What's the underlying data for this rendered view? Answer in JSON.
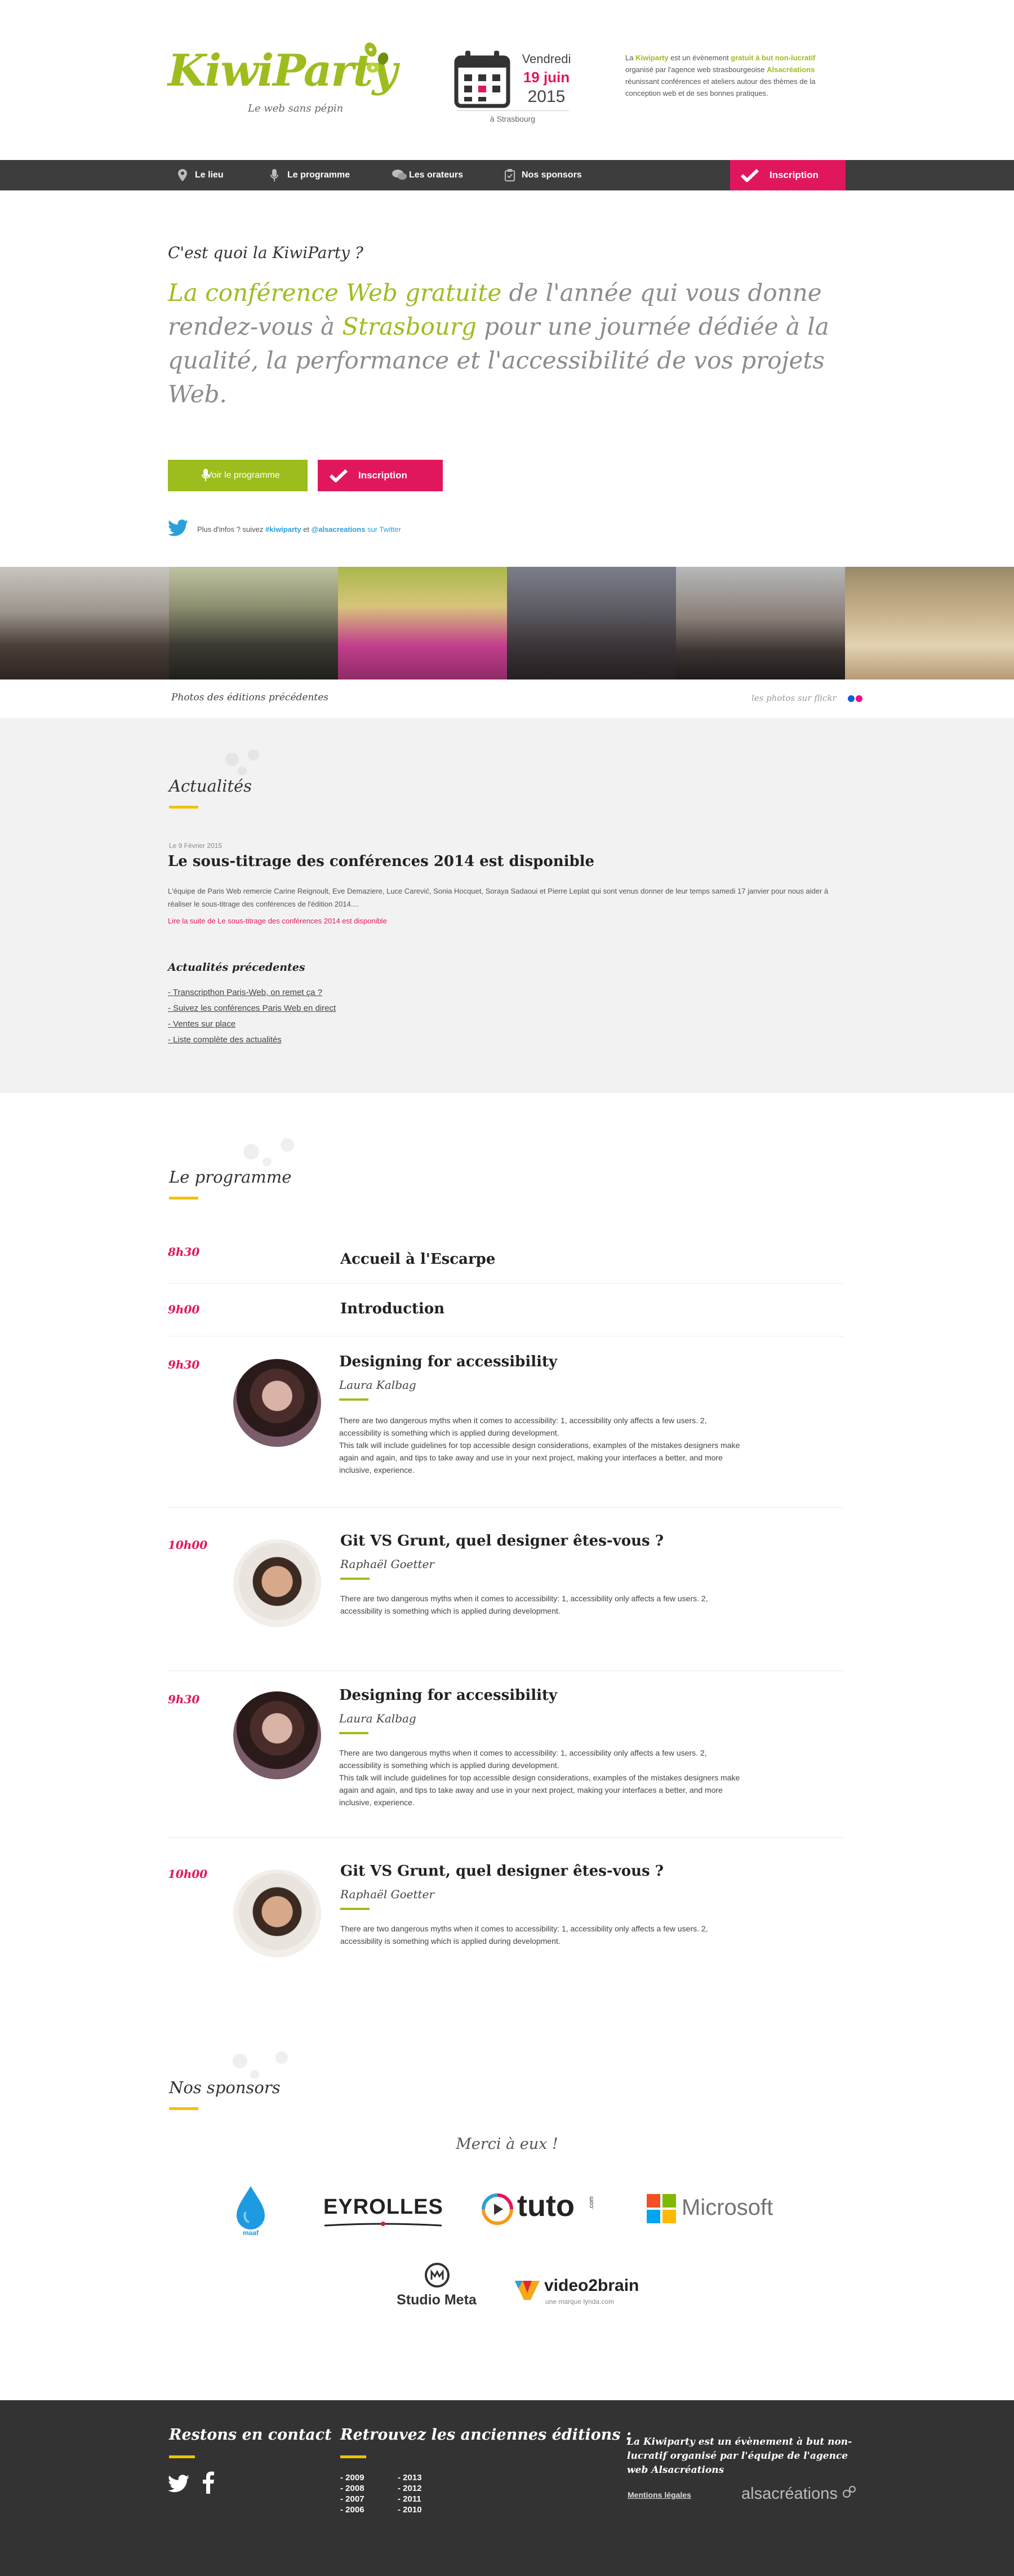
{
  "header": {
    "logo": "KiwiParty",
    "tagline": "Le web sans pépin",
    "date": {
      "day": "Vendredi",
      "date": "19 juin",
      "year": "2015",
      "place": "à Strasbourg"
    },
    "intro": {
      "p1": "La ",
      "brand": "Kiwiparty",
      "p2": " est un évènement ",
      "free": "gratuit à but non-lucratif",
      "p3": " organisé par l'agence web strasbourgeoise ",
      "agency": "Alsacréations",
      "p4": " réunissant conférences et ateliers autour des thèmes de la conception web et de ses bonnes pratiques."
    }
  },
  "nav": {
    "items": [
      "Le lieu",
      "Le programme",
      "Les orateurs",
      "Nos sponsors"
    ],
    "register": "Inscription"
  },
  "hero": {
    "question": "C'est quoi la KiwiParty ?",
    "t1": "La conférence Web gratuite",
    "t2": " de l'année qui vous donne rendez-vous à ",
    "t3": "Strasbourg",
    "t4": " pour une journée dédiée à la qualité, la performance et l'accessibilité de vos projets Web.",
    "btn_programme": "Voir le programme",
    "btn_register": "Inscription",
    "twitter": {
      "p1": "Plus d'infos ? suivez ",
      "h1": "#kiwiparty",
      "p2": " et ",
      "h2": "@alsacreations",
      "p3": " sur Twitter"
    }
  },
  "photos": {
    "caption": "Photos des éditions précédentes",
    "flickr": "les photos sur flickr"
  },
  "news": {
    "title": "Actualités",
    "date": "Le 9 Février 2015",
    "headline": "Le sous-titrage des conférences 2014 est disponible",
    "body": "L'équipe de Paris Web remercie Carine Reignoult, Eve Demaziere, Luce Carević, Sonia Hocquet, Soraya Sadaoui et Pierre Leplat qui sont venus donner de leur temps samedi 17 janvier pour nous aider à réaliser le sous-titrage des conférences de l'édition 2014....",
    "more": "Lire la suite de Le sous-titrage des conférences 2014 est disponible",
    "previous_title": "Actualités précedentes",
    "previous": [
      "- Transcripthon Paris-Web, on remet ça ?",
      "- Suivez les conférences Paris Web en direct",
      "- Ventes sur place",
      "- Liste complète des actualités"
    ]
  },
  "programme": {
    "title": "Le programme",
    "simple": [
      {
        "time": "8h30",
        "title": "Accueil à l'Escarpe"
      },
      {
        "time": "9h00",
        "title": "Introduction"
      }
    ],
    "talks": [
      {
        "time": "9h30",
        "title": "Designing for accessibility",
        "speaker": "Laura Kalbag",
        "d1": "There are two dangerous myths when it comes to accessibility: 1, accessibility only affects a few users. 2, accessibility is something which is applied during development.",
        "d2": "This talk will include guidelines for top accessible design considerations, examples of the mistakes designers make again and again, and tips to take away and use in your next project, making your interfaces a better, and more inclusive, experience."
      },
      {
        "time": "10h00",
        "title": "Git VS Grunt, quel designer êtes-vous ?",
        "speaker": "Raphaël Goetter",
        "d1": "There are two dangerous myths when it comes to accessibility: 1, accessibility only affects a few users. 2, accessibility is something which is applied during development.",
        "d2": ""
      },
      {
        "time": "9h30",
        "title": "Designing for accessibility",
        "speaker": "Laura Kalbag",
        "d1": "There are two dangerous myths when it comes to accessibility: 1, accessibility only affects a few users. 2, accessibility is something which is applied during development.",
        "d2": "This talk will include guidelines for top accessible design considerations, examples of the mistakes designers make again and again, and tips to take away and use in your next project, making your interfaces a better, and more inclusive, experience."
      },
      {
        "time": "10h00",
        "title": "Git VS Grunt, quel designer êtes-vous ?",
        "speaker": "Raphaël Goetter",
        "d1": "There are two dangerous myths when it comes to accessibility: 1, accessibility only affects a few users. 2, accessibility is something which is applied during development.",
        "d2": ""
      }
    ]
  },
  "sponsors": {
    "title": "Nos sponsors",
    "thanks": "Merci à eux !",
    "names": [
      "maaf",
      "EYROLLES",
      "tuto",
      ".com",
      "Microsoft",
      "Studio Meta",
      "video2brain",
      "une marque lynda.com"
    ]
  },
  "footer": {
    "contact": "Restons en contact",
    "editions": "Retrouvez les anciennes éditions :",
    "years_a": [
      "- 2009",
      "- 2008",
      "- 2007",
      "- 2006"
    ],
    "years_b": [
      "- 2013",
      "- 2012",
      "- 2011",
      "- 2010"
    ],
    "note": "La Kiwiparty est un évènement à but non-lucratif organisé par l'équipe de l'agence web Alsacréations",
    "legal": "Mentions légales",
    "brand": "alsacréations"
  },
  "colors": {
    "green": "#9dbd1f",
    "pink": "#e0175f",
    "dark": "#3d3d3d",
    "yellow": "#f2c200",
    "twitter": "#2a9fd8"
  }
}
